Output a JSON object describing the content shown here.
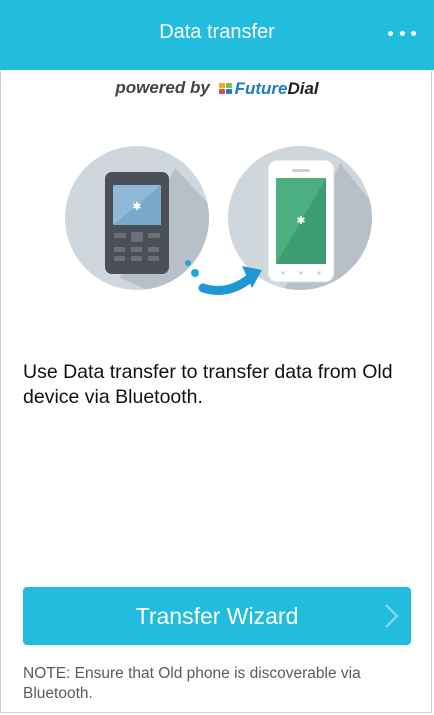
{
  "app": {
    "title": "Data transfer",
    "more_icon": "more-horizontal-icon",
    "accent_color": "#22bcdf"
  },
  "branding": {
    "powered_by": "powered by",
    "logo_text_future": "Future",
    "logo_text_dial": "Dial",
    "logo_icon": "futuredial-logo-icon"
  },
  "illustration": {
    "old_device_icon": "feature-phone-bluetooth-icon",
    "transfer_arrow_icon": "transfer-arrow-icon",
    "new_device_icon": "smartphone-bluetooth-icon"
  },
  "description": "Use Data transfer to transfer data from Old device via Bluetooth.",
  "wizard_button": {
    "label": "Transfer Wizard",
    "icon": "chevron-right-icon"
  },
  "note": "NOTE: Ensure that Old phone is discoverable via Bluetooth."
}
